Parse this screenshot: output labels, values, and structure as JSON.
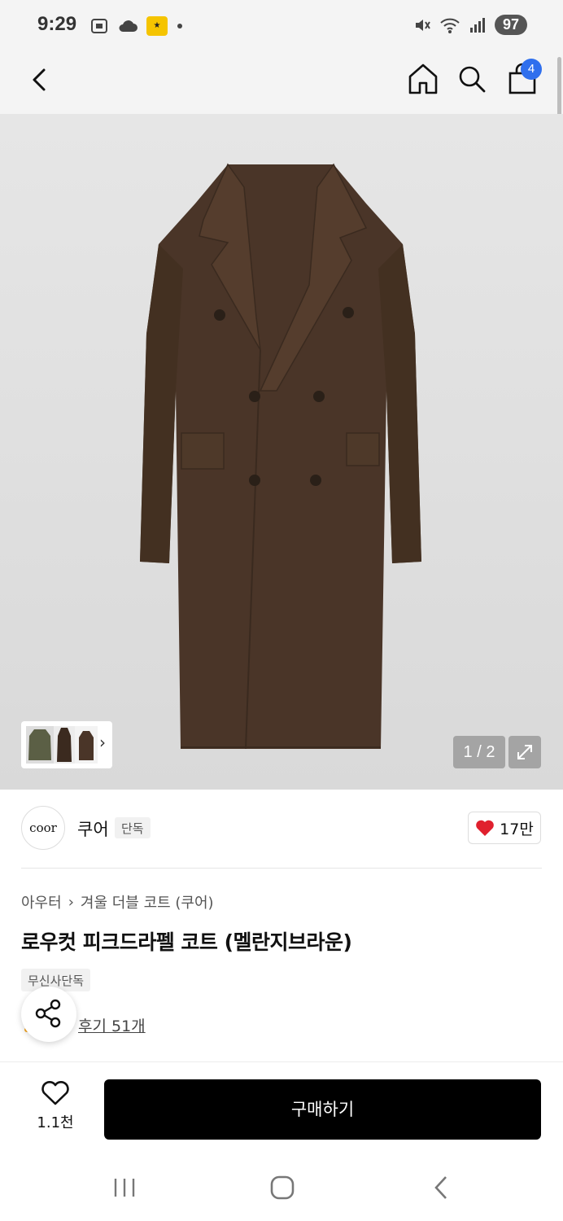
{
  "status": {
    "time": "9:29",
    "battery": "97"
  },
  "header": {
    "cart_count": "4",
    "icons": [
      "back-icon",
      "home-icon",
      "search-icon",
      "shopping-bag-icon"
    ]
  },
  "gallery": {
    "page_indicator": "1 / 2"
  },
  "brand": {
    "logo_text": "coor",
    "name": "쿠어",
    "exclusive_label": "단독",
    "likes": "17만"
  },
  "product": {
    "breadcrumb_category": "아우터",
    "breadcrumb_sub": "겨울 더블 코트 (쿠어)",
    "title": "로우컷 피크드라펠 코트 (멜란지브라운)",
    "tag": "무신사단독",
    "reviews": "후기 51개"
  },
  "bottom": {
    "wish_count": "1.1천",
    "buy_label": "구매하기"
  },
  "colors": {
    "accent_badge": "#2f6fed",
    "heart": "#e0202e",
    "buy_button": "#000000",
    "coat": "#4a3528"
  }
}
